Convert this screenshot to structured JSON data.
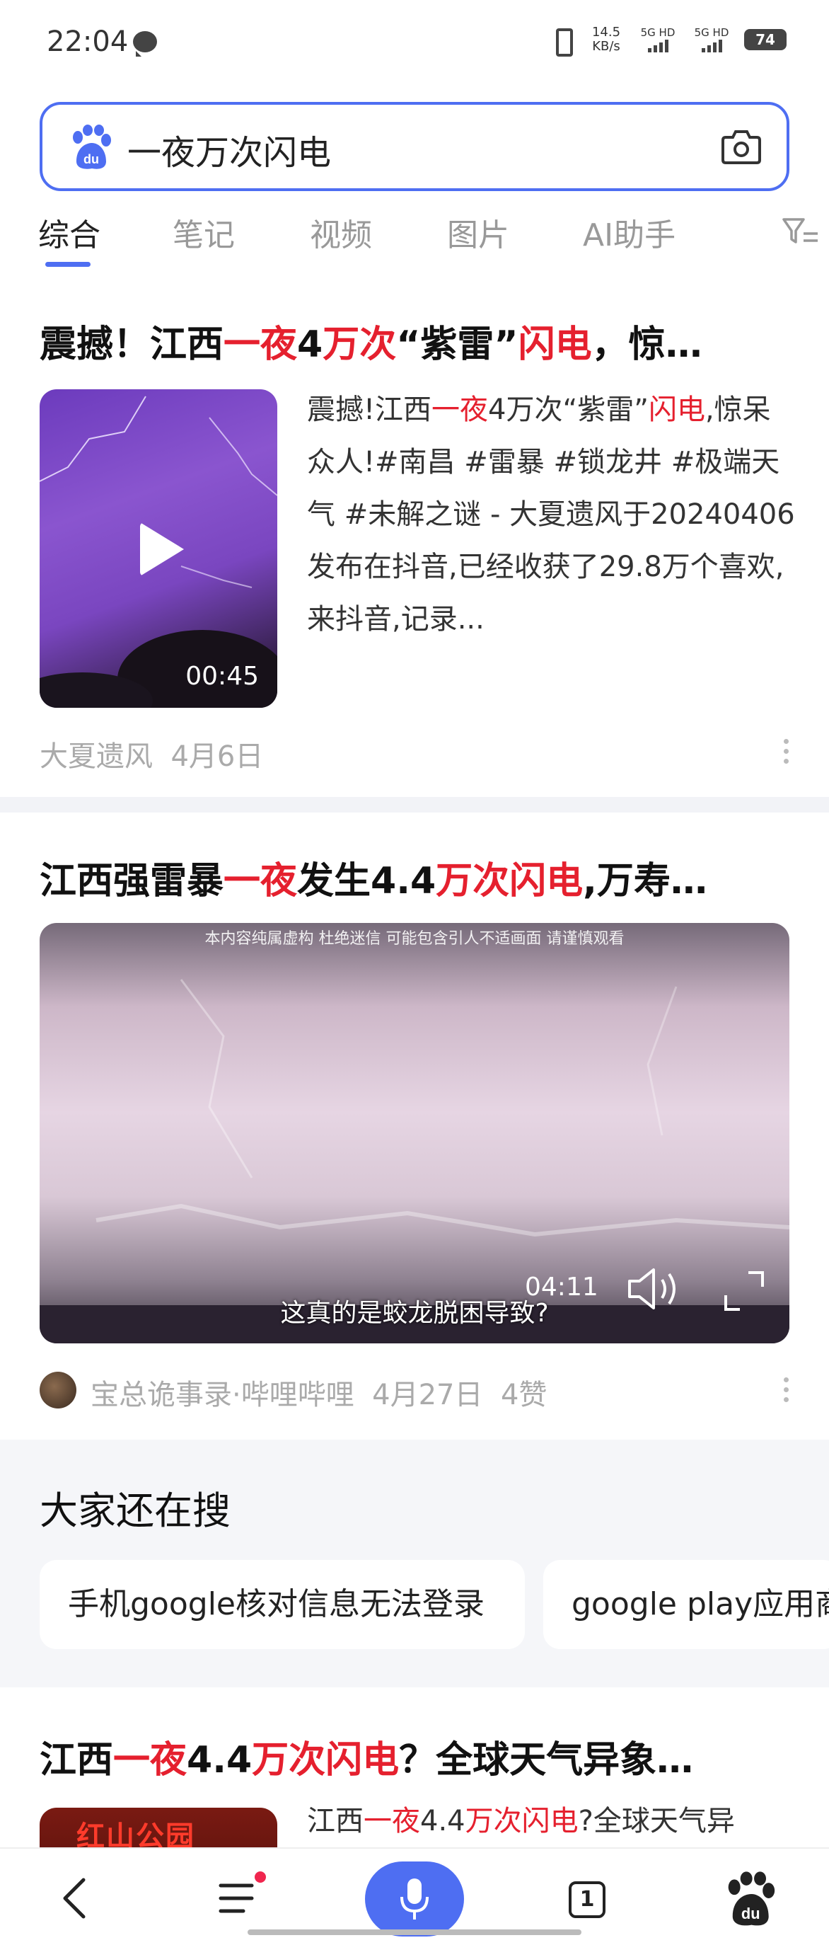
{
  "status_bar": {
    "time": "22:04",
    "net_speed_value": "14.5",
    "net_speed_unit": "KB/s",
    "signal_1": "5G HD",
    "signal_2": "5G HD",
    "battery": "74"
  },
  "search": {
    "query": "一夜万次闪电"
  },
  "tabs": [
    {
      "label": "综合"
    },
    {
      "label": "笔记"
    },
    {
      "label": "视频"
    },
    {
      "label": "图片"
    },
    {
      "label": "AI助手"
    }
  ],
  "results": [
    {
      "title": [
        "震撼！江西",
        "一夜",
        "4",
        "万次",
        "“紫雷”",
        "闪电",
        "，惊…"
      ],
      "snippet": [
        "震撼!江西",
        "一夜",
        "4万次“紫雷”",
        "闪电",
        ",惊呆众人!#南昌 #雷暴 #锁龙井 #极端天气 #未解之谜 - 大夏遗风于20240406发布在抖音,已经收获了29.8万个喜欢,来抖音,记录..."
      ],
      "duration": "00:45",
      "source": "大夏遗风",
      "date": "4月6日"
    },
    {
      "title": [
        "江西强雷暴",
        "一夜",
        "发生4.4",
        "万次闪电",
        ",万寿…"
      ],
      "video_notice": "本内容纯属虚构 杜绝迷信 可能包含引人不适画面 请谨慎观看",
      "video_subtitle": "这真的是蛟龙脱困导致?",
      "duration": "04:11",
      "source": "宝总诡事录·哔哩哔哩",
      "date": "4月27日",
      "likes": "4赞"
    },
    {
      "title": [
        "江西",
        "一夜",
        "4.4",
        "万次闪电",
        "？全球天气异象…"
      ],
      "snippet": [
        "江西",
        "一夜",
        "4.4",
        "万次闪电",
        "?全球天气异"
      ],
      "thumb_text": "红山公园"
    }
  ],
  "suggest": {
    "title": "大家还在搜",
    "chips": [
      "手机google核对信息无法登录",
      "google play应用商"
    ]
  },
  "bottom_nav": {
    "tab_count": "1"
  },
  "colors": {
    "accent": "#4e6ef2",
    "highlight": "#e5202e"
  }
}
